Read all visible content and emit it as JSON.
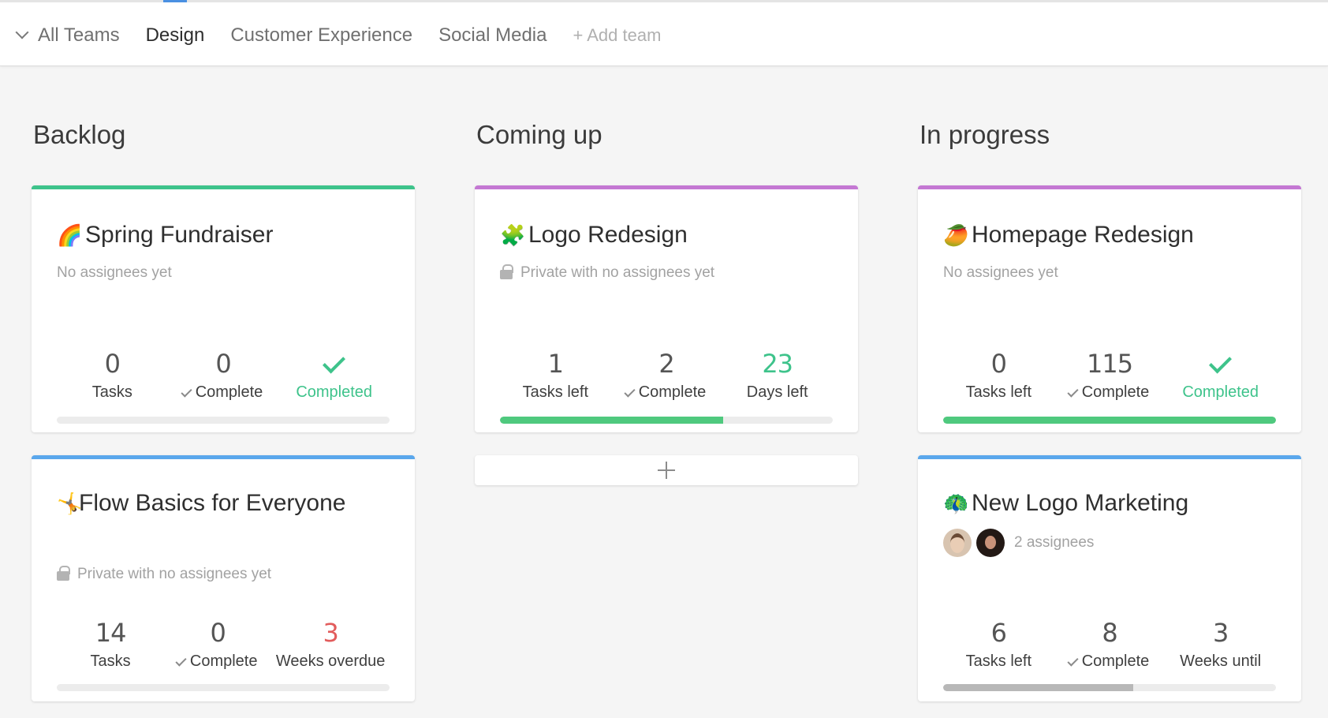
{
  "nav": {
    "teams": [
      {
        "label": "All Teams"
      },
      {
        "label": "Design"
      },
      {
        "label": "Customer Experience"
      },
      {
        "label": "Social Media"
      }
    ],
    "add_team_label": "+ Add team"
  },
  "colors": {
    "green": "#3ec38b",
    "purple": "#c478d3",
    "blue": "#5aa7ec",
    "overdue_red": "#e25c5c",
    "progress_green": "#4fc97e",
    "progress_grey": "#b8b8b8"
  },
  "columns": [
    {
      "title": "Backlog",
      "cards": [
        {
          "emoji": "🌈",
          "title": "Spring Fundraiser",
          "subtitle": "No assignees yet",
          "stats": [
            {
              "value": "0",
              "label": "Tasks"
            },
            {
              "value": "0",
              "label": "Complete"
            },
            {
              "value": "",
              "label": "Completed"
            }
          ],
          "progress": 0
        },
        {
          "emoji": "🤸",
          "title": "Flow Basics for Everyone",
          "subtitle": "Private with no assignees yet",
          "stats": [
            {
              "value": "14",
              "label": "Tasks"
            },
            {
              "value": "0",
              "label": "Complete"
            },
            {
              "value": "3",
              "label": "Weeks overdue"
            }
          ],
          "progress": 0
        }
      ]
    },
    {
      "title": "Coming up",
      "cards": [
        {
          "emoji": "🧩",
          "title": "Logo Redesign",
          "subtitle": "Private with no assignees yet",
          "stats": [
            {
              "value": "1",
              "label": "Tasks left"
            },
            {
              "value": "2",
              "label": "Complete"
            },
            {
              "value": "23",
              "label": "Days left"
            }
          ],
          "progress": 0.67
        }
      ]
    },
    {
      "title": "In progress",
      "cards": [
        {
          "emoji": "🥭",
          "title": "Homepage Redesign",
          "subtitle": "No assignees yet",
          "stats": [
            {
              "value": "0",
              "label": "Tasks left"
            },
            {
              "value": "115",
              "label": "Complete"
            },
            {
              "value": "",
              "label": "Completed"
            }
          ],
          "progress": 1
        },
        {
          "emoji": "🦚",
          "title": "New Logo Marketing",
          "subtitle": "2 assignees",
          "stats": [
            {
              "value": "6",
              "label": "Tasks left"
            },
            {
              "value": "8",
              "label": "Complete"
            },
            {
              "value": "3",
              "label": "Weeks until"
            }
          ],
          "progress": 0.57
        }
      ]
    }
  ]
}
